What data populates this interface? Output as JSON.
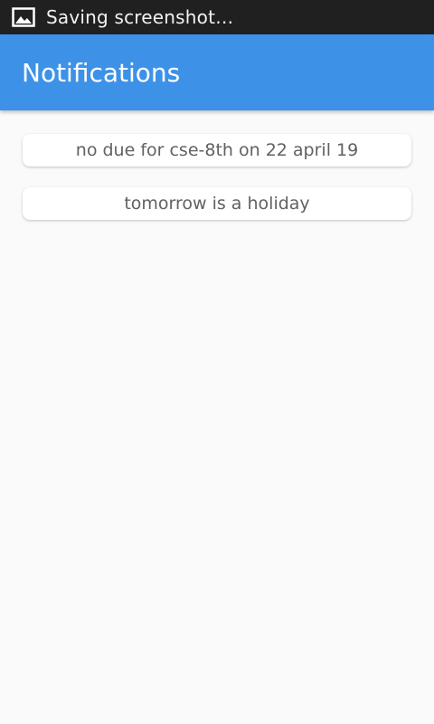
{
  "status_bar": {
    "icon": "image-icon",
    "text": "Saving screenshot…"
  },
  "app_bar": {
    "title": "Notifications",
    "color": "#3d92e8"
  },
  "notifications": [
    {
      "text": "no due for cse-8th on 22 april 19"
    },
    {
      "text": "tomorrow is a holiday"
    }
  ]
}
